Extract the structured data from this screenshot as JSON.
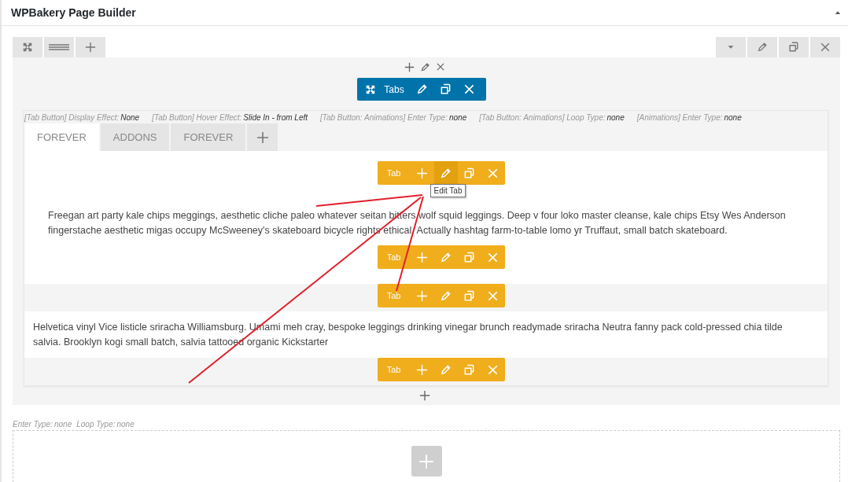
{
  "header": {
    "title": "WPBakery Page Builder"
  },
  "element": {
    "label": "Tabs"
  },
  "meta": [
    {
      "label": "[Tab Button] Display Effect:",
      "value": "None"
    },
    {
      "label": "[Tab Button] Hover Effect:",
      "value": "Slide In - from Left"
    },
    {
      "label": "[Tab Button: Animations] Enter Type:",
      "value": "none"
    },
    {
      "label": "[Tab Button: Animations] Loop Type:",
      "value": "none"
    },
    {
      "label": "[Animations] Enter Type:",
      "value": "none"
    }
  ],
  "tabs": [
    {
      "label": "FOREVER",
      "selected": true
    },
    {
      "label": "ADDONS",
      "selected": false
    },
    {
      "label": "FOREVER",
      "selected": false
    }
  ],
  "sections": [
    {
      "top": {
        "label": "Tab",
        "tooltip": "Edit Tab"
      },
      "bottom": {
        "label": "Tab"
      },
      "active": true,
      "text": "Freegan art party kale chips meggings, aesthetic cliche paleo whatever seitan bitters wolf squid leggings. Deep v four loko master cleanse, kale chips Etsy Wes Anderson fingerstache aesthetic migas occupy McSweeney's skateboard bicycle rights ethical. Actually hashtag farm-to-table lomo yr Truffaut, small batch skateboard."
    },
    {
      "top": {
        "label": "Tab"
      },
      "bottom": {
        "label": "Tab"
      },
      "active": false,
      "text": "Helvetica vinyl Vice listicle sriracha Williamsburg. Umami meh cray, bespoke leggings drinking vinegar brunch readymade sriracha Neutra fanny pack cold-pressed chia tilde salvia. Brooklyn kogi small batch, salvia tattooed organic Kickstarter"
    }
  ],
  "row_meta": [
    {
      "label": "Enter Type:",
      "value": "none"
    },
    {
      "label": "Loop Type:",
      "value": "none"
    }
  ]
}
